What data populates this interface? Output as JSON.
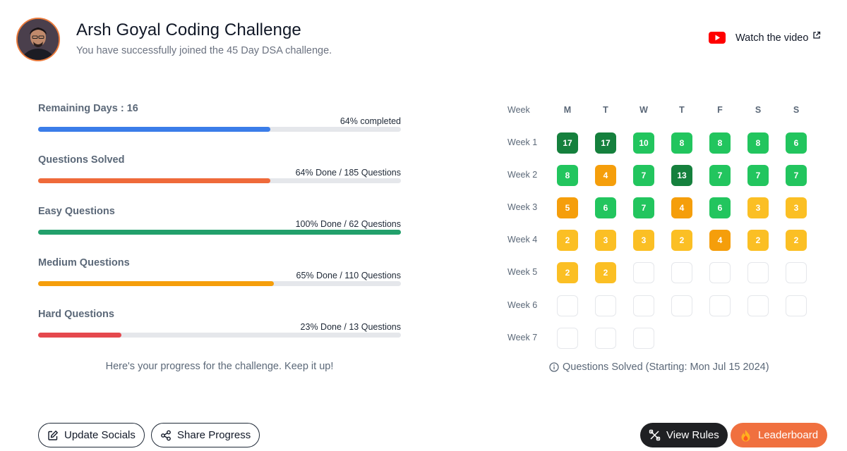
{
  "header": {
    "title": "Arsh Goyal Coding Challenge",
    "subtitle": "You have successfully joined the 45 Day DSA challenge.",
    "watch_label": "Watch the video"
  },
  "progress": [
    {
      "label": "Remaining Days : 16",
      "detail": "64% completed",
      "percent": 64,
      "color": "#3b7de9"
    },
    {
      "label": "Questions Solved",
      "detail": "64% Done / 185 Questions",
      "percent": 64,
      "color": "#ef6a3a"
    },
    {
      "label": "Easy Questions",
      "detail": "100% Done / 62 Questions",
      "percent": 100,
      "color": "#22a06b"
    },
    {
      "label": "Medium Questions",
      "detail": "65% Done / 110 Questions",
      "percent": 65,
      "color": "#f59e0b"
    },
    {
      "label": "Hard Questions",
      "detail": "23% Done / 13 Questions",
      "percent": 23,
      "color": "#e5484d"
    }
  ],
  "progress_note": "Here's your progress for the challenge. Keep it up!",
  "calendar": {
    "header_label": "Week",
    "days": [
      "M",
      "T",
      "W",
      "T",
      "F",
      "S",
      "S"
    ],
    "weeks": [
      {
        "label": "Week 1",
        "cells": [
          17,
          17,
          10,
          8,
          8,
          8,
          6
        ]
      },
      {
        "label": "Week 2",
        "cells": [
          8,
          4,
          7,
          13,
          7,
          7,
          7
        ]
      },
      {
        "label": "Week 3",
        "cells": [
          5,
          6,
          7,
          4,
          6,
          3,
          3
        ]
      },
      {
        "label": "Week 4",
        "cells": [
          2,
          3,
          3,
          2,
          4,
          2,
          2
        ]
      },
      {
        "label": "Week 5",
        "cells": [
          2,
          2,
          null,
          null,
          null,
          null,
          null
        ]
      },
      {
        "label": "Week 6",
        "cells": [
          null,
          null,
          null,
          null,
          null,
          null,
          null
        ]
      },
      {
        "label": "Week 7",
        "cells": [
          null,
          null,
          null
        ]
      }
    ],
    "colors": {
      "dark_green": "#15803d",
      "green": "#22c55e",
      "orange": "#f59e0b",
      "yellow": "#fbbf24"
    },
    "note": "Questions Solved (Starting: Mon Jul 15 2024)"
  },
  "buttons": {
    "update_socials": "Update Socials",
    "share_progress": "Share Progress",
    "view_rules": "View Rules",
    "leaderboard": "Leaderboard"
  },
  "icons": {
    "watch": "youtube-icon",
    "external": "external-link-icon",
    "info": "info-icon",
    "edit": "edit-icon",
    "share": "share-icon",
    "rules": "tools-icon",
    "leaderboard": "flame-icon"
  }
}
